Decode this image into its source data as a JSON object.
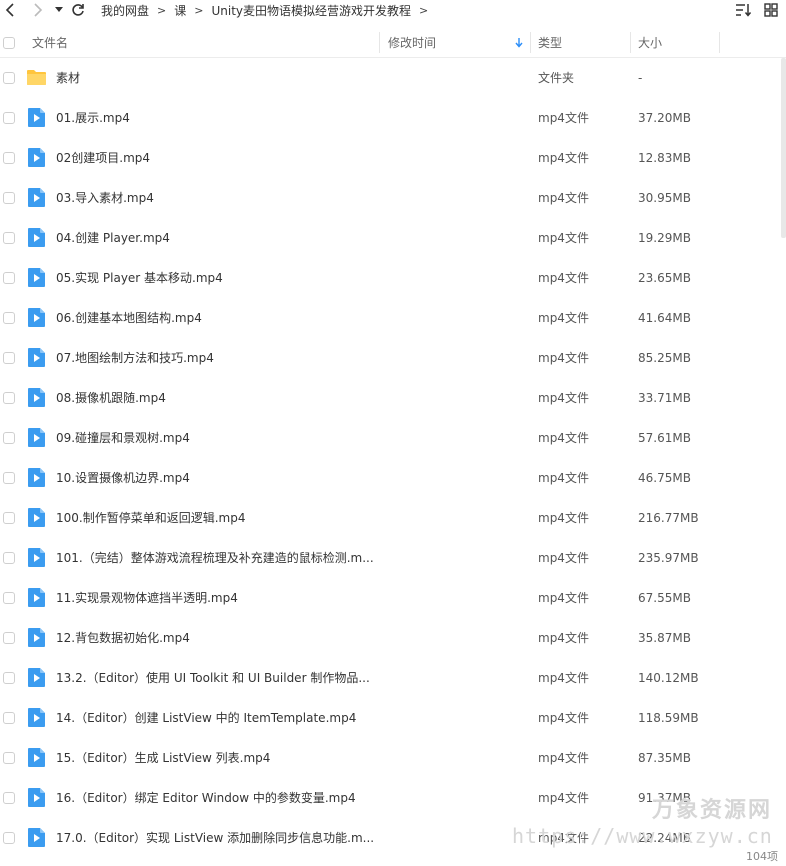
{
  "breadcrumb": [
    "我的网盘",
    "课",
    "Unity麦田物语模拟经营游戏开发教程"
  ],
  "header": {
    "name": "文件名",
    "modified": "修改时间",
    "type": "类型",
    "size": "大小"
  },
  "files": [
    {
      "name": "素材",
      "type": "文件夹",
      "size": "-",
      "kind": "folder"
    },
    {
      "name": "01.展示.mp4",
      "type": "mp4文件",
      "size": "37.20MB",
      "kind": "video"
    },
    {
      "name": "02创建项目.mp4",
      "type": "mp4文件",
      "size": "12.83MB",
      "kind": "video"
    },
    {
      "name": "03.导入素材.mp4",
      "type": "mp4文件",
      "size": "30.95MB",
      "kind": "video"
    },
    {
      "name": "04.创建 Player.mp4",
      "type": "mp4文件",
      "size": "19.29MB",
      "kind": "video"
    },
    {
      "name": "05.实现 Player 基本移动.mp4",
      "type": "mp4文件",
      "size": "23.65MB",
      "kind": "video"
    },
    {
      "name": "06.创建基本地图结构.mp4",
      "type": "mp4文件",
      "size": "41.64MB",
      "kind": "video"
    },
    {
      "name": "07.地图绘制方法和技巧.mp4",
      "type": "mp4文件",
      "size": "85.25MB",
      "kind": "video"
    },
    {
      "name": "08.摄像机跟随.mp4",
      "type": "mp4文件",
      "size": "33.71MB",
      "kind": "video"
    },
    {
      "name": "09.碰撞层和景观树.mp4",
      "type": "mp4文件",
      "size": "57.61MB",
      "kind": "video"
    },
    {
      "name": "10.设置摄像机边界.mp4",
      "type": "mp4文件",
      "size": "46.75MB",
      "kind": "video"
    },
    {
      "name": "100.制作暂停菜单和返回逻辑.mp4",
      "type": "mp4文件",
      "size": "216.77MB",
      "kind": "video"
    },
    {
      "name": "101.（完结）整体游戏流程梳理及补充建造的鼠标检测.m...",
      "type": "mp4文件",
      "size": "235.97MB",
      "kind": "video"
    },
    {
      "name": "11.实现景观物体遮挡半透明.mp4",
      "type": "mp4文件",
      "size": "67.55MB",
      "kind": "video"
    },
    {
      "name": "12.背包数据初始化.mp4",
      "type": "mp4文件",
      "size": "35.87MB",
      "kind": "video"
    },
    {
      "name": "13.2.（Editor）使用 UI Toolkit 和 UI Builder 制作物品...",
      "type": "mp4文件",
      "size": "140.12MB",
      "kind": "video"
    },
    {
      "name": "14.（Editor）创建 ListView 中的 ItemTemplate.mp4",
      "type": "mp4文件",
      "size": "118.59MB",
      "kind": "video"
    },
    {
      "name": "15.（Editor）生成 ListView 列表.mp4",
      "type": "mp4文件",
      "size": "87.35MB",
      "kind": "video"
    },
    {
      "name": "16.（Editor）绑定 Editor Window 中的参数变量.mp4",
      "type": "mp4文件",
      "size": "91.37MB",
      "kind": "video"
    },
    {
      "name": "17.0.（Editor）实现 ListView 添加删除同步信息功能.m...",
      "type": "mp4文件",
      "size": "22.24MB",
      "kind": "video"
    }
  ],
  "watermark": {
    "title": "万象资源网",
    "url": "https://www.wxzyw.cn"
  },
  "footer": {
    "count": "104项"
  },
  "colors": {
    "folder": "#ffc53d",
    "video": "#3b9cf0",
    "accent": "#2c8ef8"
  }
}
